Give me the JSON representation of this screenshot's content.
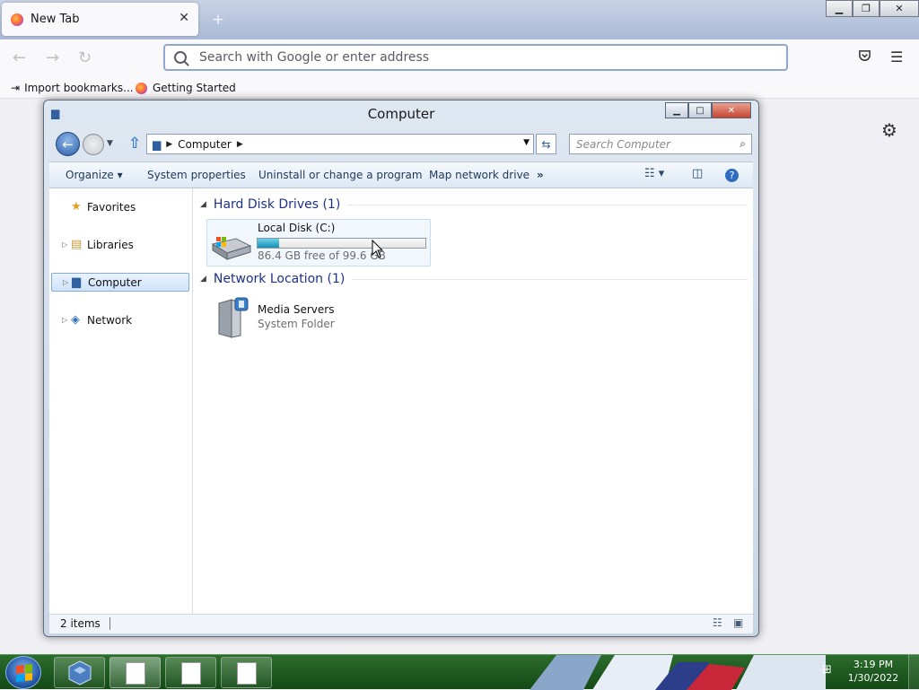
{
  "browser": {
    "tab_title": "New Tab",
    "tab_close": "✕",
    "new_tab": "+",
    "url_placeholder": "Search with Google or enter address",
    "bookmarks": [
      "Import bookmarks...",
      "Getting Started"
    ]
  },
  "explorer": {
    "title": "Computer",
    "address": {
      "crumbs": [
        "Computer"
      ]
    },
    "search_placeholder": "Search Computer",
    "commands": {
      "organize": "Organize",
      "system_properties": "System properties",
      "uninstall": "Uninstall or change a program",
      "map_drive": "Map network drive",
      "overflow": "»"
    },
    "nav": [
      {
        "label": "Favorites",
        "icon": "star-icon"
      },
      {
        "label": "Libraries",
        "icon": "libraries-icon"
      },
      {
        "label": "Computer",
        "icon": "computer-icon",
        "selected": true
      },
      {
        "label": "Network",
        "icon": "network-icon"
      }
    ],
    "groups": [
      {
        "header": "Hard Disk Drives (1)"
      },
      {
        "header": "Network Location (1)"
      }
    ],
    "drive": {
      "name": "Local Disk (C:)",
      "free_text": "86.4 GB free of 99.6 GB",
      "used_fraction": 0.13
    },
    "network_item": {
      "name": "Media Servers",
      "type": "System Folder"
    },
    "status": {
      "items": "2 items"
    }
  },
  "taskbar": {
    "time": "3:19 PM",
    "date": "1/30/2022"
  },
  "colors": {
    "explorer_group_header": "#1e3287",
    "selection_fill": "#cfe3fb",
    "progress_fill": "#1b8fb5",
    "taskbar": "#144a16"
  }
}
